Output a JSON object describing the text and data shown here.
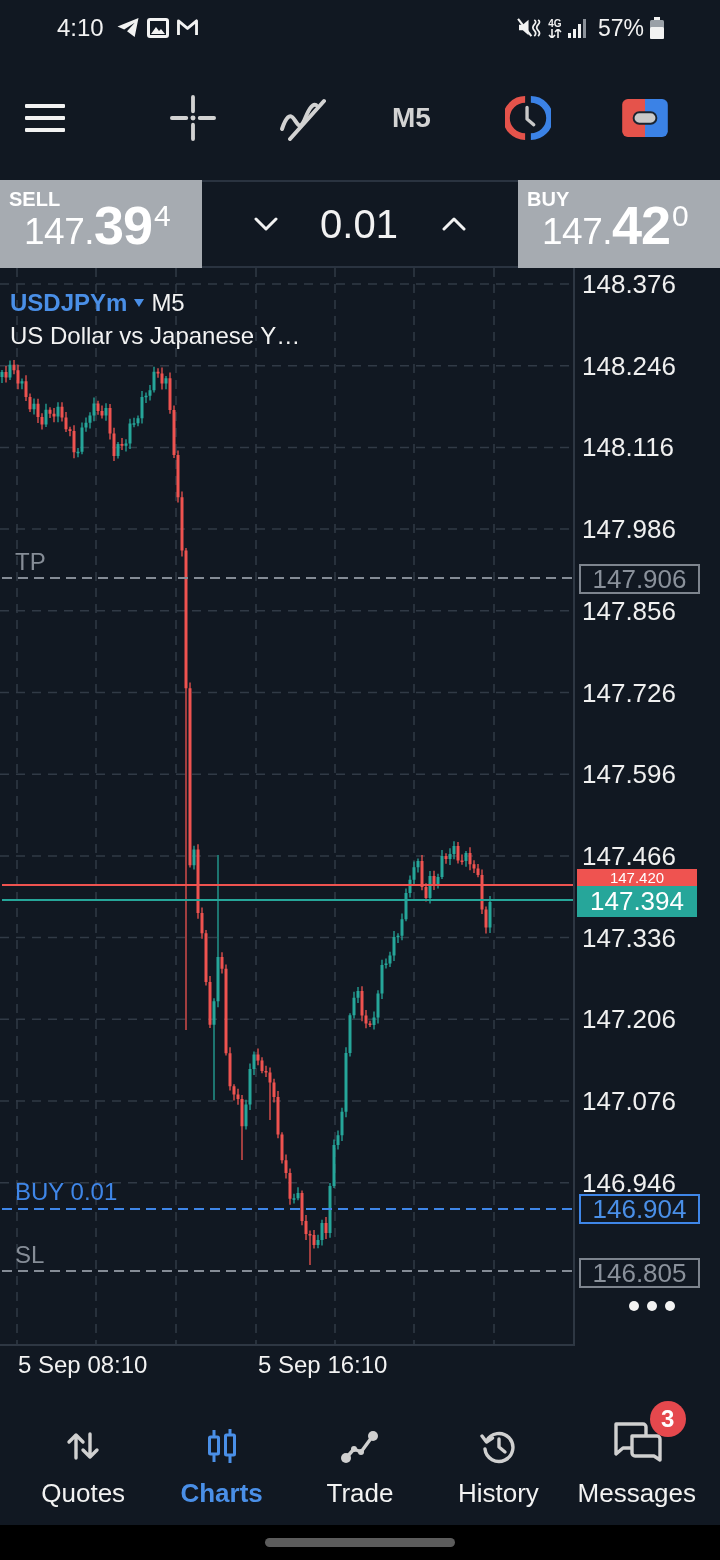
{
  "status_bar": {
    "time": "4:10",
    "network": "4G",
    "battery": "57%"
  },
  "toolbar": {
    "timeframe": "M5"
  },
  "trade_panel": {
    "sell": {
      "label": "SELL",
      "price": "147.**39**$^{4}$"
    },
    "volume": "0.01",
    "buy": {
      "label": "BUY",
      "price": "147.**42**$^{0}$"
    }
  },
  "chart": {
    "symbol": "USDJPYm",
    "timeframe": "M5",
    "description": "US Dollar vs Japanese Y…",
    "price_ticks": [
      "148.376",
      "148.246",
      "148.116",
      "147.986",
      "147.856",
      "147.726",
      "147.596",
      "147.466",
      "147.336",
      "147.206",
      "147.076",
      "146.946"
    ],
    "levels": [
      {
        "kind": "take_profit",
        "label": "TP",
        "price": "147.906"
      },
      {
        "kind": "ask",
        "price": "147.420"
      },
      {
        "kind": "bid",
        "price": "147.394"
      },
      {
        "kind": "position",
        "label": "BUY 0.01",
        "price": "146.904"
      },
      {
        "kind": "stop_loss",
        "label": "SL",
        "price": "146.805"
      }
    ],
    "time_labels": [
      "5 Sep 08:10",
      "5 Sep 16:10"
    ]
  },
  "bottom_nav": [
    {
      "label": "Quotes",
      "selected": false
    },
    {
      "label": "Charts",
      "selected": true
    },
    {
      "label": "Trade",
      "selected": false
    },
    {
      "label": "History",
      "selected": false
    },
    {
      "label": "Messages",
      "selected": false,
      "badge": "3"
    }
  ]
}
